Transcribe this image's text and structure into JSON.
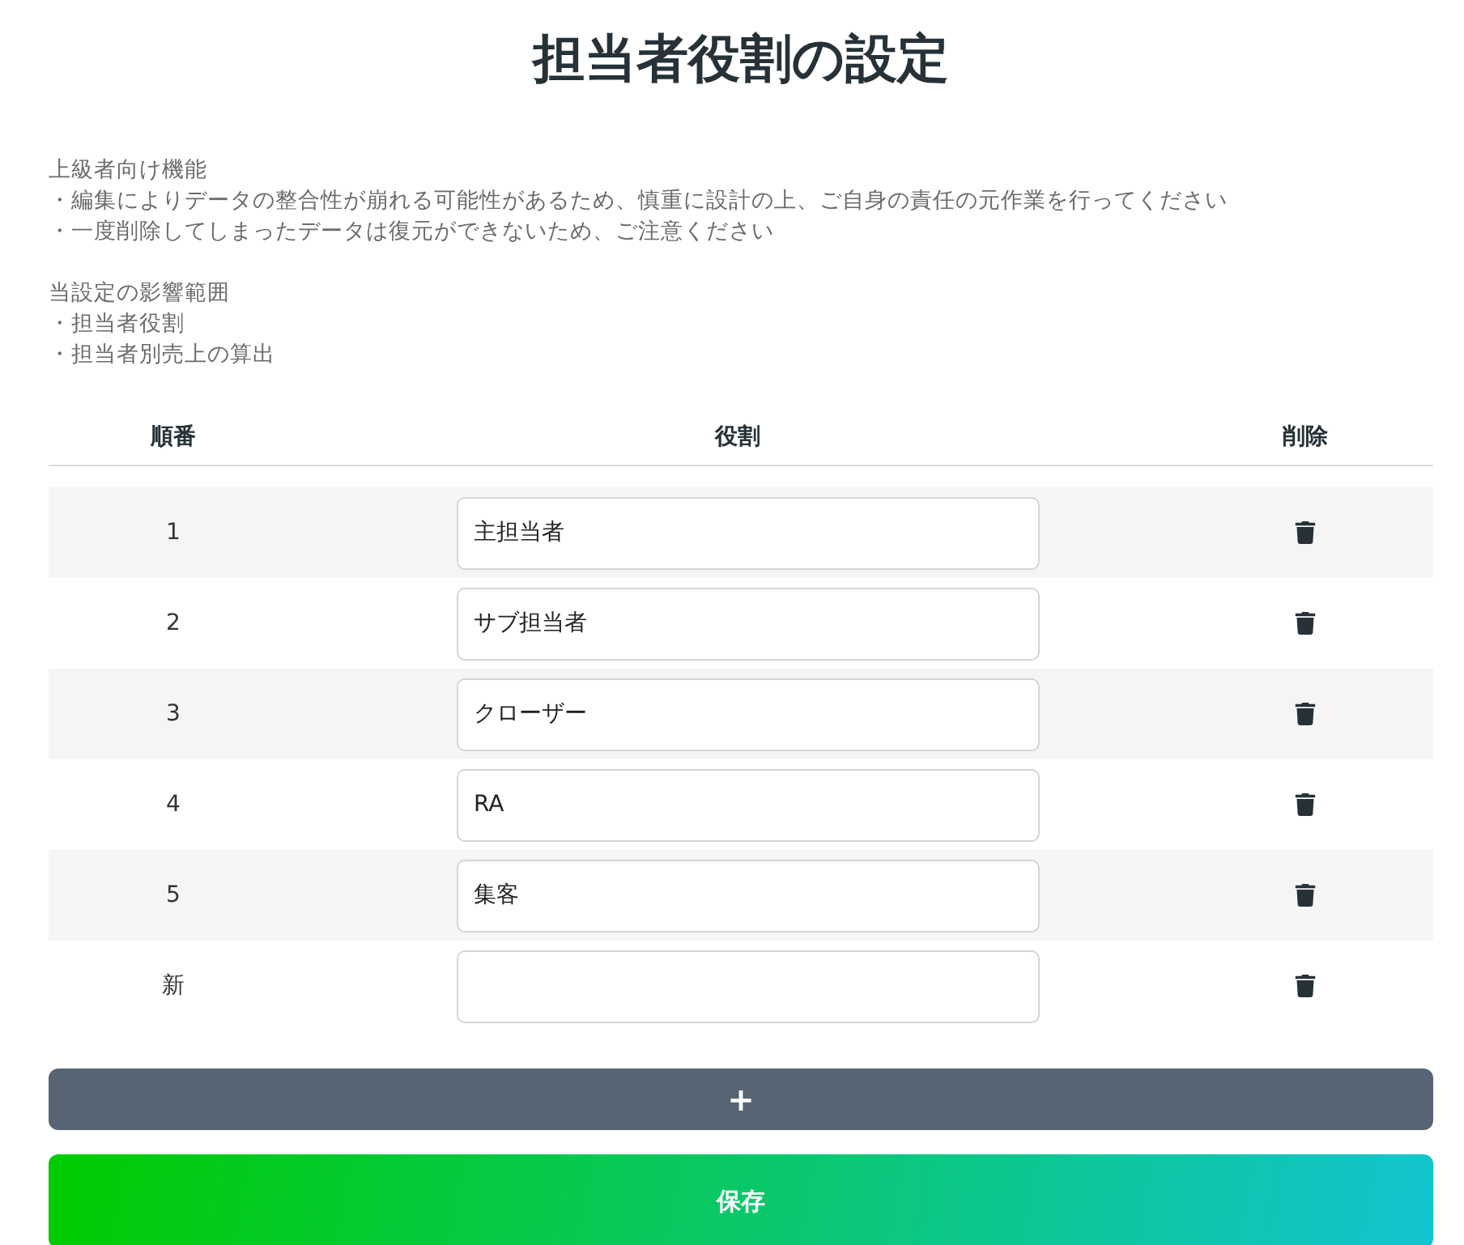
{
  "title": "担当者役割の設定",
  "notes": [
    {
      "heading": "上級者向け機能",
      "items": [
        "・編集によりデータの整合性が崩れる可能性があるため、慎重に設計の上、ご自身の責任の元作業を行ってください",
        "・一度削除してしまったデータは復元ができないため、ご注意ください"
      ]
    },
    {
      "heading": "当設定の影響範囲",
      "items": [
        "・担当者役割",
        "・担当者別売上の算出"
      ]
    }
  ],
  "table": {
    "columns": [
      "順番",
      "役割",
      "削除"
    ],
    "rows": [
      {
        "order": "1",
        "role": "主担当者"
      },
      {
        "order": "2",
        "role": "サブ担当者"
      },
      {
        "order": "3",
        "role": "クローザー"
      },
      {
        "order": "4",
        "role": "RA"
      },
      {
        "order": "5",
        "role": "集客"
      },
      {
        "order": "新",
        "role": ""
      }
    ]
  },
  "add_button": "+",
  "save_button": "保存"
}
